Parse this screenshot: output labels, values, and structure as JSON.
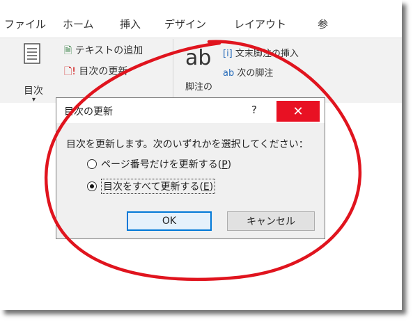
{
  "tabs": [
    "ファイル",
    "ホーム",
    "挿入",
    "デザイン",
    "レイアウト",
    "参"
  ],
  "ribbon": {
    "toc_label": "目次",
    "add_text": "テキストの追加",
    "update_toc": "目次の更新",
    "ab_glyph": "ab",
    "footnote_label": "脚注の",
    "insert_endnote": "文末脚注の挿入",
    "next_footnote": "次の脚注"
  },
  "dialog": {
    "title": "目次の更新",
    "help": "?",
    "close": "✕",
    "prompt": "目次を更新します。次のいずれかを選択してください：",
    "options": [
      {
        "label": "ページ番号だけを更新する(",
        "accel": "P",
        "suffix": ")",
        "selected": false
      },
      {
        "label": "目次をすべて更新する(",
        "accel": "E",
        "suffix": ")",
        "selected": true
      }
    ],
    "ok": "OK",
    "cancel": "キャンセル"
  },
  "colors": {
    "annotation_red": "#e0141e",
    "close_red": "#e81123",
    "focus_blue": "#0078d7"
  }
}
